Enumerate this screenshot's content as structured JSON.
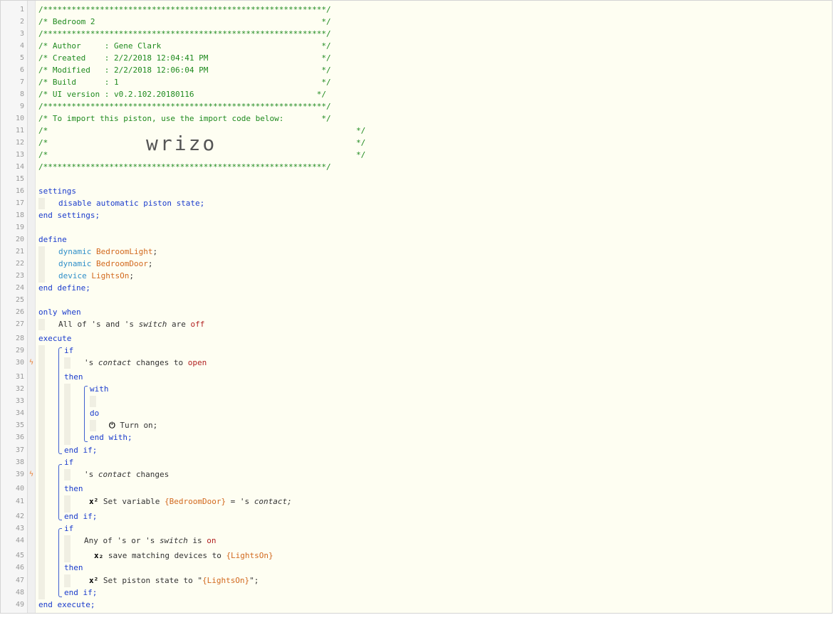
{
  "header": {
    "rule": "/************************************************************/",
    "title_line": "/* Bedroom 2                                                */",
    "author_line": "/* Author     : Gene Clark                                  */",
    "created_line": "/* Created    : 2/2/2018 12:04:41 PM                        */",
    "modified_line": "/* Modified   : 2/2/2018 12:06:04 PM                        */",
    "build_line": "/* Build      : 1                                           */",
    "ui_line": "/* UI version : v0.2.102.20180116                          */",
    "import_line": "/* To import this piston, use the import code below:        */",
    "blank_line_start": "/*",
    "blank_line_end": "*/",
    "import_code": "wrizo"
  },
  "line_numbers": [
    "1",
    "2",
    "3",
    "4",
    "5",
    "6",
    "7",
    "8",
    "9",
    "10",
    "11",
    "12",
    "13",
    "14",
    "15",
    "16",
    "17",
    "18",
    "19",
    "20",
    "21",
    "22",
    "23",
    "24",
    "25",
    "26",
    "27",
    "28",
    "29",
    "30",
    "31",
    "32",
    "33",
    "34",
    "35",
    "36",
    "37",
    "38",
    "39",
    "40",
    "41",
    "42",
    "43",
    "44",
    "45",
    "46",
    "47",
    "48",
    "49"
  ],
  "code": {
    "settings": "settings",
    "disable": "disable automatic piston state;",
    "end_settings": "end settings;",
    "define": "define",
    "dynamic": "dynamic",
    "device": "device",
    "var_light": "BedroomLight",
    "var_door": "BedroomDoor",
    "var_lights_on": "LightsOn",
    "semicolon": ";",
    "end_define": "end define;",
    "only_when": "only when",
    "all_of": "All of 's and 's ",
    "switch": "switch",
    "are": " are ",
    "off": "off",
    "execute": "execute",
    "if": "if",
    "contact_prefix": "'s ",
    "contact": "contact",
    "changes_to": " changes to ",
    "open": "open",
    "then": "then",
    "with": "with",
    "do": "do",
    "power_icon": "⏻",
    "turn_on": " Turn on;",
    "end_with": "end with;",
    "end_if": "end if;",
    "changes": " changes",
    "x2_sup": "x²",
    "set_variable": " Set variable ",
    "door_braced": "{BedroomDoor}",
    "equals_contact": " = 's ",
    "contact_end": "contact;",
    "any_of": "Any of 's or 's ",
    "is": " is ",
    "on": "on",
    "x2_sub": "x₂",
    "save_matching": " save matching devices to ",
    "lights_on_braced": "{LightsOn}",
    "set_piston_state": " Set piston state to \"",
    "quote_end": "\";",
    "end_execute": "end execute;"
  },
  "colors": {
    "comment": "#1f8a1f",
    "keyword": "#1a3bcc",
    "type": "#2f8fc9",
    "variable": "#d2691e",
    "value": "#b22222",
    "bolt": "#e8853c"
  },
  "icons": {
    "trigger": "lightning-bolt-icon",
    "power": "power-icon"
  }
}
